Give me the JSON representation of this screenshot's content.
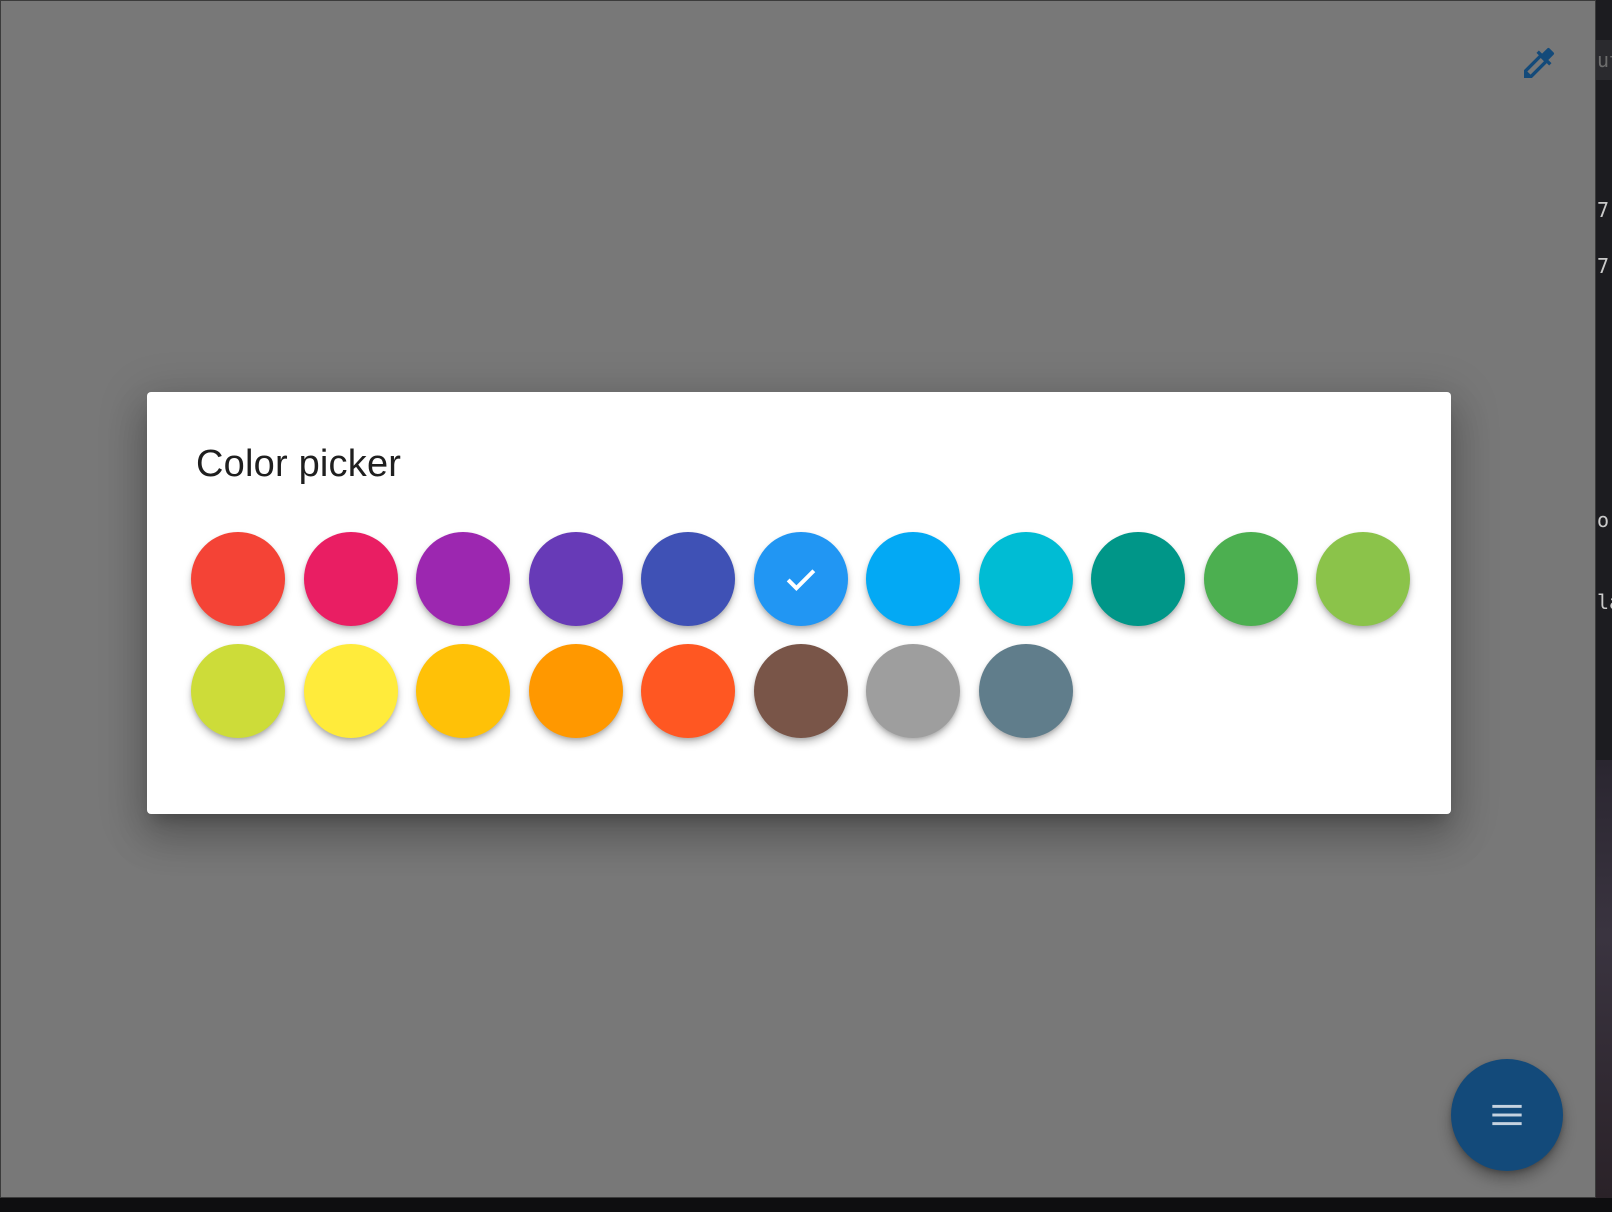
{
  "dialog": {
    "title": "Color picker"
  },
  "toolbar": {
    "eyedropper_icon": "eyedropper-icon",
    "eyedropper_color": "#134a7a"
  },
  "fab": {
    "icon": "menu-icon",
    "color": "#134a7a"
  },
  "overlay_color": "#787878",
  "selected_index": 5,
  "swatches": [
    {
      "name": "red",
      "color": "#F44336"
    },
    {
      "name": "pink",
      "color": "#E91E63"
    },
    {
      "name": "purple",
      "color": "#9C27B0"
    },
    {
      "name": "deep-purple",
      "color": "#673AB7"
    },
    {
      "name": "indigo",
      "color": "#3F51B5"
    },
    {
      "name": "blue",
      "color": "#2196F3"
    },
    {
      "name": "light-blue",
      "color": "#03A9F4"
    },
    {
      "name": "cyan",
      "color": "#00BCD4"
    },
    {
      "name": "teal",
      "color": "#009688"
    },
    {
      "name": "green",
      "color": "#4CAF50"
    },
    {
      "name": "light-green",
      "color": "#8BC34A"
    },
    {
      "name": "lime",
      "color": "#CDDC39"
    },
    {
      "name": "yellow",
      "color": "#FFEB3B"
    },
    {
      "name": "amber",
      "color": "#FFC107"
    },
    {
      "name": "orange",
      "color": "#FF9800"
    },
    {
      "name": "deep-orange",
      "color": "#FF5722"
    },
    {
      "name": "brown",
      "color": "#795548"
    },
    {
      "name": "grey",
      "color": "#9E9E9E"
    },
    {
      "name": "blue-grey",
      "color": "#607D8B"
    }
  ]
}
